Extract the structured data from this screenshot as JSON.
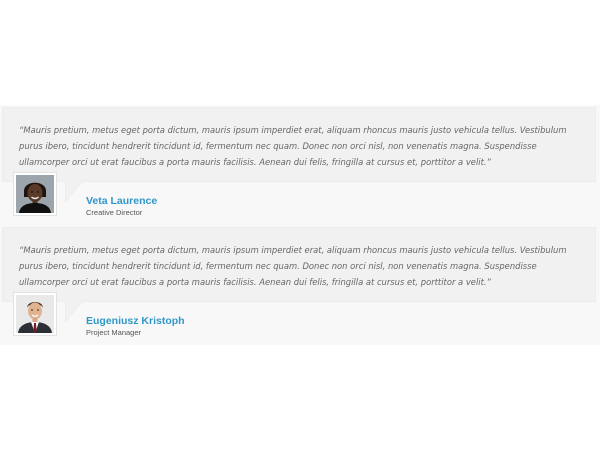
{
  "testimonials": [
    {
      "quote": "“Mauris pretium, metus eget porta dictum, mauris ipsum imperdiet erat, aliquam rhoncus mauris justo vehicula tellus. Vestibulum purus ibero, tincidunt hendrerit tincidunt id, fermentum nec quam. Donec non orci nisl, non venenatis magna. Suspendisse ullamcorper orci ut erat faucibus a porta mauris facilisis. Aenean dui felis, fringilla at cursus et, porttitor a velit.”",
      "name": "Veta Laurence",
      "role": "Creative Director",
      "avatar_icon": "woman-portrait-icon"
    },
    {
      "quote": "“Mauris pretium, metus eget porta dictum, mauris ipsum imperdiet erat, aliquam rhoncus mauris justo vehicula tellus. Vestibulum purus ibero, tincidunt hendrerit tincidunt id, fermentum nec quam. Donec non orci nisl, non venenatis magna. Suspendisse ullamcorper orci ut erat faucibus a porta mauris facilisis. Aenean dui felis, fringilla at cursus et, porttitor a velit.”",
      "name": "Eugeniusz Kristoph",
      "role": "Project Manager",
      "avatar_icon": "man-portrait-icon"
    }
  ],
  "colors": {
    "accent": "#2f97c8",
    "quote_background": "#f1f1f1",
    "section_background": "#f8f8f8"
  }
}
